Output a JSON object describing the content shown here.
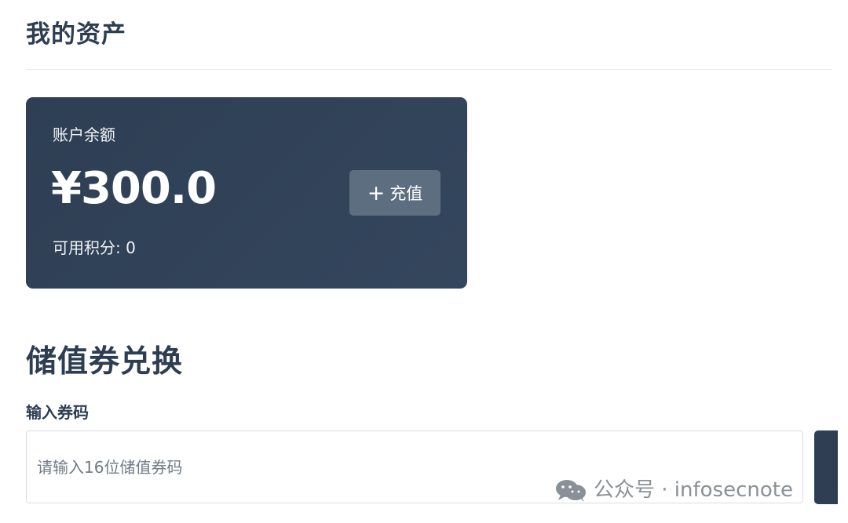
{
  "page": {
    "title": "我的资产"
  },
  "balance_card": {
    "label": "账户余额",
    "amount": "¥300.0",
    "recharge_button": {
      "icon": "plus-icon",
      "icon_glyph": "+",
      "label": "充值"
    },
    "points_text": "可用积分: 0"
  },
  "voucher_section": {
    "title": "储值券兑换",
    "field_label": "输入券码",
    "input": {
      "value": "",
      "placeholder": "请输入16位储值券码"
    }
  },
  "watermark": {
    "icon": "wechat-icon",
    "text": "公众号 · infosecnote"
  },
  "colors": {
    "primary_text": "#2d3e52",
    "card_background": "#2e3f54",
    "recharge_button": "#5d6e80",
    "divider": "#e8ebee",
    "input_border": "#d9dde2"
  }
}
